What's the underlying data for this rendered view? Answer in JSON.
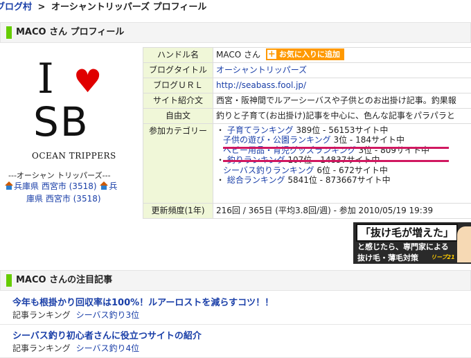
{
  "breadcrumb": {
    "home": "ブログ村",
    "sep": ">",
    "current": "オーシャントリッパーズ プロフィール"
  },
  "profile_heading": "MACO さん プロフィール",
  "logo": {
    "i": "I",
    "heart": "♥",
    "sb": "SB",
    "tagline": "OCEAN TRIPPERS",
    "sub": "---オーシャン トリッパーズ---"
  },
  "location": {
    "first": "兵庫県 西宮市 (3518)",
    "second_a": "兵",
    "second_b": "庫県 西宮市 (3518)"
  },
  "info": {
    "handle_label": "ハンドル名",
    "handle": "MACO さん",
    "fav_button": "お気に入りに追加",
    "blog_title_label": "ブログタイトル",
    "blog_title": "オーシャントリッパーズ",
    "url_label": "ブログＵＲＬ",
    "url": "http://seabass.fool.jp/",
    "intro_label": "サイト紹介文",
    "intro": "西宮・阪神間でルアーシーバスや子供とのお出掛け記事。釣果報",
    "free_label": "自由文",
    "free": "釣りと子育て(お出掛け)記事を中心に、色んな記事をパラパラと",
    "category_label": "参加カテゴリー",
    "categories": [
      {
        "bullet": "・",
        "name": "子育てランキング",
        "rank": "389位 - 56153サイト中"
      },
      {
        "bullet": "",
        "name": "子供の遊び・公園ランキング",
        "rank": "3位 - 184サイト中"
      },
      {
        "bullet": "",
        "name": "ベビー用品・育児グッズランキング",
        "rank": "3位 - 809サイト中"
      },
      {
        "bullet": "・",
        "name": "釣りランキング",
        "rank": "107位 - 14837サイト中"
      },
      {
        "bullet": "",
        "name": "シーバス釣りランキング",
        "rank": "6位 - 672サイト中"
      },
      {
        "bullet": "・",
        "name": "総合ランキング",
        "rank": "5841位 - 873667サイト中"
      }
    ],
    "freq_label": "更新頻度(1年)",
    "freq": "216回 / 365日 (平均3.8回/週) - 参加 2010/05/19 19:39"
  },
  "ad": {
    "headline": "「抜け毛が増えた」",
    "line2": "と感じたら、専門家による",
    "line3": "抜け毛・薄毛対策",
    "brand": "リーブ21"
  },
  "featured_heading": "MACO さんの注目記事",
  "articles": [
    {
      "title": "今年も根掛かり回収率は100%！ルアーロストを減らすコツ！！",
      "meta": "記事ランキング",
      "rank": "シーバス釣り3位"
    },
    {
      "title": "シーバス釣り初心者さんに役立つサイトの紹介",
      "meta": "記事ランキング",
      "rank": "シーバス釣り4位"
    }
  ],
  "colors": {
    "accent_green": "#66cc00",
    "link_blue": "#1a3fa8",
    "fav_orange": "#ff9900",
    "underline_magenta": "#d01860"
  }
}
